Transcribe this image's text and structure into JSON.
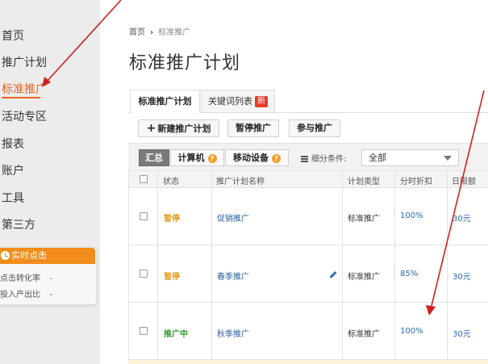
{
  "sidebar": {
    "items": [
      {
        "label": "首页"
      },
      {
        "label": "推广计划"
      },
      {
        "label": "标准推广"
      },
      {
        "label": "活动专区"
      },
      {
        "label": "报表"
      },
      {
        "label": "账户"
      },
      {
        "label": "工具"
      },
      {
        "label": "第三方"
      }
    ],
    "realtime": {
      "title": "实时点击",
      "rows": [
        {
          "label": "点击转化率",
          "value": "-"
        },
        {
          "label": "投入产出比",
          "value": "-"
        }
      ]
    }
  },
  "breadcrumb": {
    "home": "首页",
    "current": "标准推广"
  },
  "page_title": "标准推广计划",
  "tabs": [
    {
      "label": "标准推广计划"
    },
    {
      "label": "关键词列表",
      "badge": "新"
    }
  ],
  "toolbar": {
    "new": "新建推广计划",
    "pause": "暂停推广",
    "join": "参与推广"
  },
  "filters": {
    "segments": [
      "汇总",
      "计算机",
      "移动设备"
    ],
    "help": "?",
    "condition_label": "细分条件:",
    "condition_value": "全部"
  },
  "table": {
    "headers": [
      "状态",
      "推广计划名称",
      "计划类型",
      "分时折扣",
      "日限额"
    ],
    "rows": [
      {
        "status": "暂停",
        "name": "促销推广",
        "type": "标准推广",
        "discount": "100%",
        "limit": "30元"
      },
      {
        "status": "暂停",
        "name": "春季推广",
        "type": "标准推广",
        "discount": "85%",
        "limit": "30元"
      },
      {
        "status": "推广中",
        "name": "秋季推广",
        "type": "标准推广",
        "discount": "100%",
        "limit": "30元"
      }
    ]
  },
  "colors": {
    "accent": "#e8651b",
    "arrow": "#d21f1f",
    "paused": "#e59a1c",
    "running": "#2e9a2e",
    "link": "#2a5d99"
  }
}
